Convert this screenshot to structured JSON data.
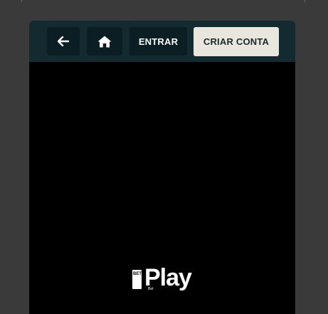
{
  "header": {
    "back_icon": "arrow-left-icon",
    "home_icon": "home-icon",
    "login_label": "ENTRAR",
    "signup_label": "CRIAR CONTA"
  },
  "logo": {
    "text": "Play",
    "badge_top": "BET",
    "sub": "Bet"
  },
  "colors": {
    "page_bg": "#3a3a3a",
    "header_bg": "#122a30",
    "button_bg": "#0a1e23",
    "signup_bg": "#e9e6dd",
    "content_bg": "#000000"
  }
}
